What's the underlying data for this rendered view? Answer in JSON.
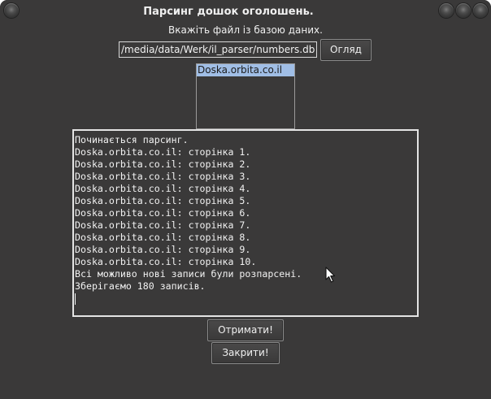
{
  "window": {
    "title": "Парсинг дошок оголошень."
  },
  "file_prompt": {
    "label": "Вкажіть файл із базою даних.",
    "path_value": "/media/data/Werk/il_parser/numbers.db",
    "browse_label": "Огляд"
  },
  "sites_list": {
    "items": [
      {
        "label": "Doska.orbita.co.il",
        "selected": true
      }
    ]
  },
  "log": {
    "lines": [
      "Починається парсинг.",
      "Doska.orbita.co.il: сторінка 1.",
      "Doska.orbita.co.il: сторінка 2.",
      "Doska.orbita.co.il: сторінка 3.",
      "Doska.orbita.co.il: сторінка 4.",
      "Doska.orbita.co.il: сторінка 5.",
      "Doska.orbita.co.il: сторінка 6.",
      "Doska.orbita.co.il: сторінка 7.",
      "Doska.orbita.co.il: сторінка 8.",
      "Doska.orbita.co.il: сторінка 9.",
      "Doska.orbita.co.il: сторінка 10.",
      "Всі можливо нові записи були розпарсені.",
      "Зберігаємо 180 записів."
    ]
  },
  "actions": {
    "get_label": "Отримати!",
    "close_label": "Закрити!"
  },
  "icons": {
    "window_menu": "window-menu-icon",
    "minimize": "minimize-icon",
    "maximize": "maximize-icon",
    "close": "close-icon",
    "pointer": "mouse-pointer-icon"
  },
  "colors": {
    "window_bg": "#3a3939",
    "selection": "#a0bee6",
    "text": "#f2f2f2"
  }
}
